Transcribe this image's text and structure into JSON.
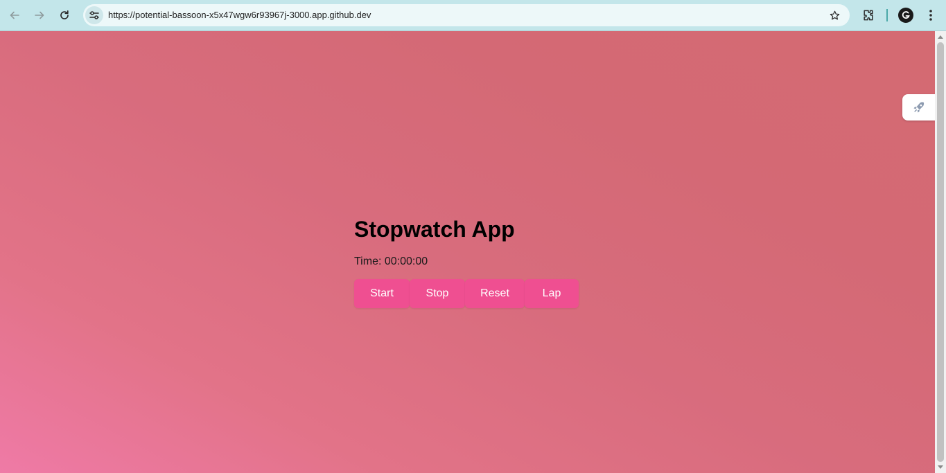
{
  "browser": {
    "url": "https://potential-bassoon-x5x47wgw6r93967j-3000.app.github.dev",
    "icons": {
      "back": "back-arrow-icon",
      "forward": "forward-arrow-icon",
      "reload": "reload-icon",
      "site_info": "tune-icon",
      "bookmark": "star-icon",
      "extensions": "puzzle-icon",
      "profile": "profile-avatar-icon",
      "menu": "kebab-menu-icon"
    },
    "colors": {
      "toolbar": "#c3e6ea",
      "omnibox": "#edf8f9"
    }
  },
  "page": {
    "title": "Stopwatch App",
    "time_label": "Time: 00:00:00",
    "buttons": {
      "start": "Start",
      "stop": "Stop",
      "reset": "Reset",
      "lap": "Lap"
    },
    "colors": {
      "button": "#ef4f91",
      "background_start": "#ef7aa6",
      "background_end": "#d46a72"
    },
    "side_widget_icon": "rocket-icon"
  }
}
